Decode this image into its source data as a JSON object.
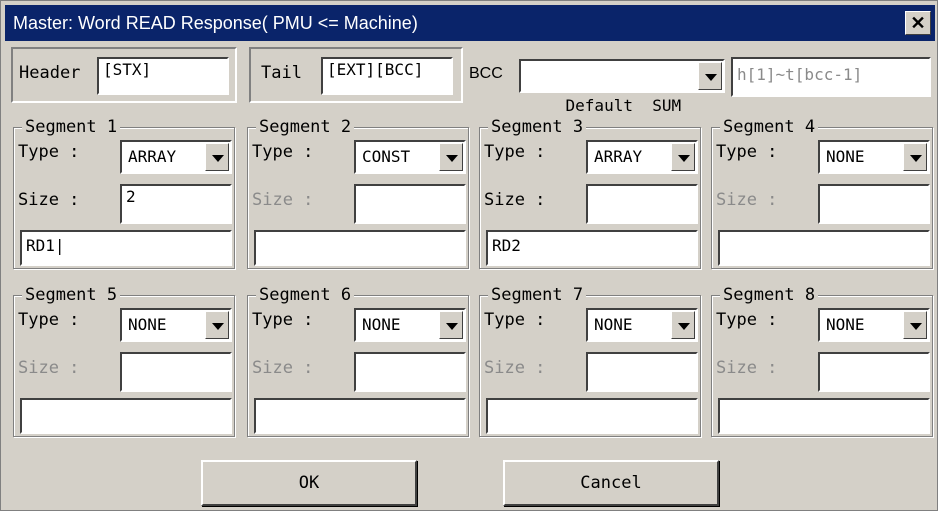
{
  "window": {
    "title": "Master: Word READ  Response( PMU <= Machine)",
    "close_glyph": "✕"
  },
  "header_row": {
    "header_label": "Header",
    "header_value": "[STX]",
    "tail_label": "Tail",
    "tail_value": "[EXT][BCC]",
    "bcc_label": "BCC",
    "bcc_selected": "Default  SUM",
    "bcc_range": "h[1]~t[bcc-1]"
  },
  "segments": [
    {
      "title": "Segment 1",
      "type_label": "Type :",
      "type": "ARRAY",
      "size_label": "Size :",
      "size": "2",
      "size_enabled": true,
      "data": "RD1|"
    },
    {
      "title": "Segment 2",
      "type_label": "Type :",
      "type": "CONST",
      "size_label": "Size :",
      "size": "",
      "size_enabled": false,
      "data": ""
    },
    {
      "title": "Segment 3",
      "type_label": "Type :",
      "type": "ARRAY",
      "size_label": "Size :",
      "size": "",
      "size_enabled": true,
      "data": "RD2"
    },
    {
      "title": "Segment 4",
      "type_label": "Type :",
      "type": "NONE",
      "size_label": "Size :",
      "size": "",
      "size_enabled": false,
      "data": ""
    },
    {
      "title": "Segment 5",
      "type_label": "Type :",
      "type": "NONE",
      "size_label": "Size :",
      "size": "",
      "size_enabled": false,
      "data": ""
    },
    {
      "title": "Segment 6",
      "type_label": "Type :",
      "type": "NONE",
      "size_label": "Size :",
      "size": "",
      "size_enabled": false,
      "data": ""
    },
    {
      "title": "Segment 7",
      "type_label": "Type :",
      "type": "NONE",
      "size_label": "Size :",
      "size": "",
      "size_enabled": false,
      "data": ""
    },
    {
      "title": "Segment 8",
      "type_label": "Type :",
      "type": "NONE",
      "size_label": "Size :",
      "size": "",
      "size_enabled": false,
      "data": ""
    }
  ],
  "buttons": {
    "ok": "OK",
    "cancel": "Cancel"
  },
  "colors": {
    "titlebar": "#0a246a",
    "dialog_face": "#d4d0c8",
    "disabled_text": "#8a8a8a"
  }
}
